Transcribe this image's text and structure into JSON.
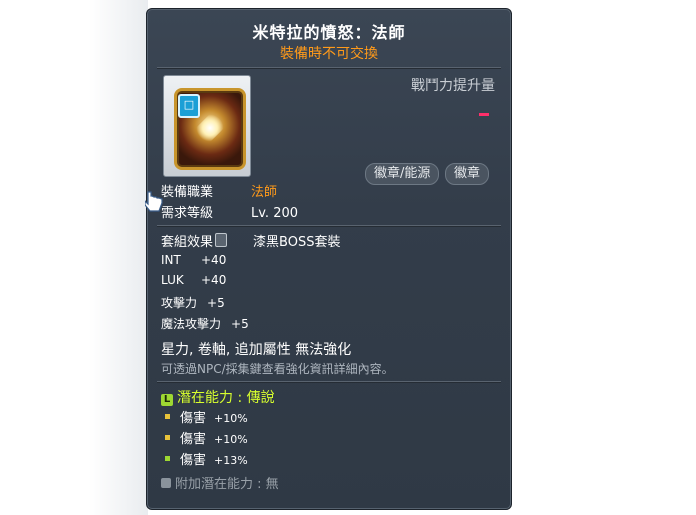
{
  "item": {
    "name": "米特拉的憤怒：法師",
    "trade_note": "裝備時不可交換",
    "icon": "mitra-rage-emblem-icon",
    "combat_power_label": "戰鬥力提升量",
    "combat_power_value": "-",
    "buttons": [
      "徽章/能源",
      "徽章"
    ]
  },
  "requirements": {
    "job_label": "裝備職業",
    "job_value": "法師",
    "level_label": "需求等級",
    "level_value": "Lv. 200"
  },
  "set": {
    "label": "套組效果",
    "name": "漆黑BOSS套裝"
  },
  "stats": [
    {
      "name": "INT",
      "value": "+40"
    },
    {
      "name": "LUK",
      "value": "+40"
    },
    {
      "name": "攻擊力",
      "value": "+5"
    },
    {
      "name": "魔法攻擊力",
      "value": "+5"
    }
  ],
  "flags": "星力, 卷軸, 追加屬性 無法強化",
  "info_note": "可透過NPC/採集鍵查看強化資訊詳細內容。",
  "potential": {
    "title": "潛在能力 : 傳說",
    "icon_letter": "L",
    "lines": [
      {
        "name": "傷害",
        "value": "+10%"
      },
      {
        "name": "傷害",
        "value": "+10%"
      },
      {
        "name": "傷害",
        "value": "+13%"
      }
    ]
  },
  "additional_potential": "附加潛在能力 : 無",
  "colors": {
    "panel": "#333d4a",
    "trade_note": "#ff9a1a",
    "job_value": "#ff9a1a",
    "potential_title": "#d8ff2e",
    "combat_power_value": "#ff2f6a"
  }
}
